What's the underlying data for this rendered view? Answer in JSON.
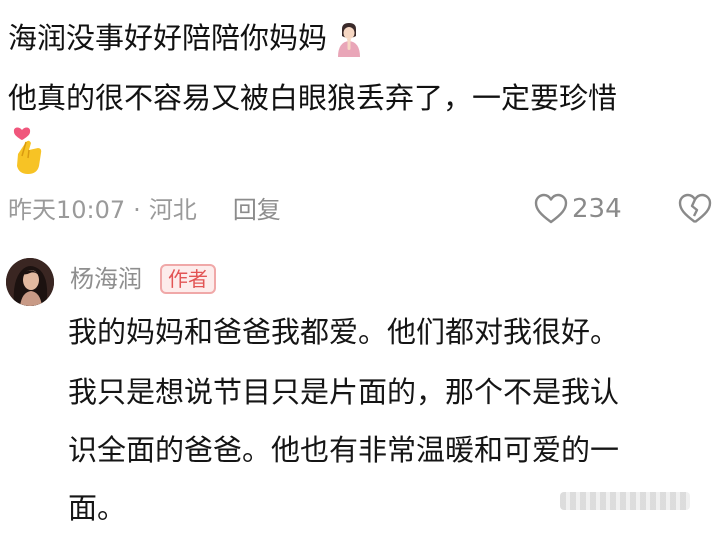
{
  "comment": {
    "line1": "海润没事好好陪陪你妈妈",
    "line2": "他真的很不容易又被白眼狼丢弃了，一定要珍惜",
    "emoji_1": "praying-woman-emoji",
    "emoji_2": "heart-hand-emoji",
    "time": "昨天10:07",
    "separator": "·",
    "location": "河北",
    "reply_label": "回复",
    "like_count": "234",
    "like_icon": "heart-outline-icon",
    "dislike_icon": "broken-heart-icon"
  },
  "reply": {
    "author_name": "杨海润",
    "author_badge": "作者",
    "avatar": "author-avatar",
    "lines": [
      "我的妈妈和爸爸我都爱。他们都对我很好。",
      "我只是想说节目只是片面的，那个不是我认",
      "识全面的爸爸。他也有非常温暖和可爱的一",
      "面。"
    ]
  },
  "colors": {
    "text": "#111111",
    "meta": "#9a9a9a",
    "badge_text": "#e25555",
    "badge_bg": "#fdeceb",
    "badge_border": "#f0a8a8"
  }
}
